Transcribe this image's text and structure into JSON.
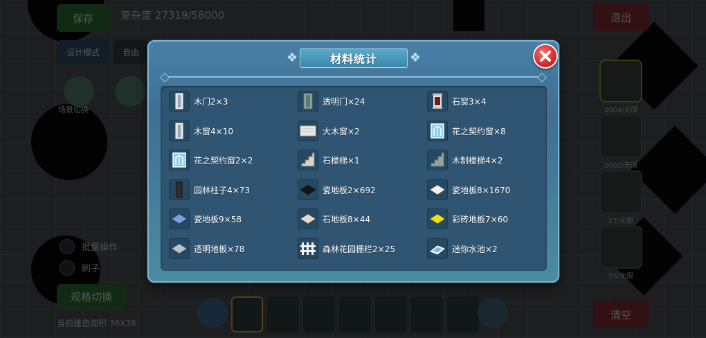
{
  "background": {
    "save_label": "保存",
    "complexity": "复杂度 27319/58000",
    "exit_label": "退出",
    "design_mode": "设计模式",
    "free_label": "自由",
    "scene_switch": "场景切换",
    "batch_op": "批量操作",
    "brush": "刷子",
    "spec_switch": "规格切换",
    "area_text": "当前建造面积 36X36",
    "clear_label": "清空",
    "slot_counts": [
      "2004/无限",
      "2002/无限",
      "27/无限",
      "25/无限"
    ]
  },
  "dialog": {
    "title": "材料统计",
    "items": [
      {
        "label": "木门2×3",
        "icon": "door-icon",
        "color": "#d9dde2"
      },
      {
        "label": "透明门×24",
        "icon": "glass-door-icon",
        "color": "#8faaa0"
      },
      {
        "label": "石窗3×4",
        "icon": "stone-window-icon",
        "color": "#e9e3e3"
      },
      {
        "label": "木窗4×10",
        "icon": "wood-window-icon",
        "color": "#d9dde2"
      },
      {
        "label": "大木窗×2",
        "icon": "large-window-icon",
        "color": "#e8e8e8"
      },
      {
        "label": "花之契约窗×8",
        "icon": "flower-window-icon",
        "color": "#8fd0e8"
      },
      {
        "label": "花之契约窗2×2",
        "icon": "flower-window-small-icon",
        "color": "#8fd0e8"
      },
      {
        "label": "石楼梯×1",
        "icon": "stone-stairs-icon",
        "color": "#d7d3cf"
      },
      {
        "label": "木制楼梯4×2",
        "icon": "wood-stairs-icon",
        "color": "#8ea59a"
      },
      {
        "label": "园林柱子4×73",
        "icon": "pillar-icon",
        "color": "#3a2a2a"
      },
      {
        "label": "瓷地板2×692",
        "icon": "black-tile-icon",
        "color": "#151515"
      },
      {
        "label": "瓷地板8×1670",
        "icon": "white-tile-icon",
        "color": "#f2f2f2"
      },
      {
        "label": "瓷地板9×58",
        "icon": "blue-tile-icon",
        "color": "#7aa0e0"
      },
      {
        "label": "石地板8×44",
        "icon": "stone-tile-icon",
        "color": "#e4dccd"
      },
      {
        "label": "彩砖地板7×60",
        "icon": "yellow-tile-icon",
        "color": "#f0e010"
      },
      {
        "label": "透明地板×78",
        "icon": "glass-floor-icon",
        "color": "#b6c4cc"
      },
      {
        "label": "森林花园栅栏2×25",
        "icon": "fence-icon",
        "color": "#f2f2f2"
      },
      {
        "label": "迷你水池×2",
        "icon": "mini-pool-icon",
        "color": "#7ab8f0"
      }
    ]
  }
}
